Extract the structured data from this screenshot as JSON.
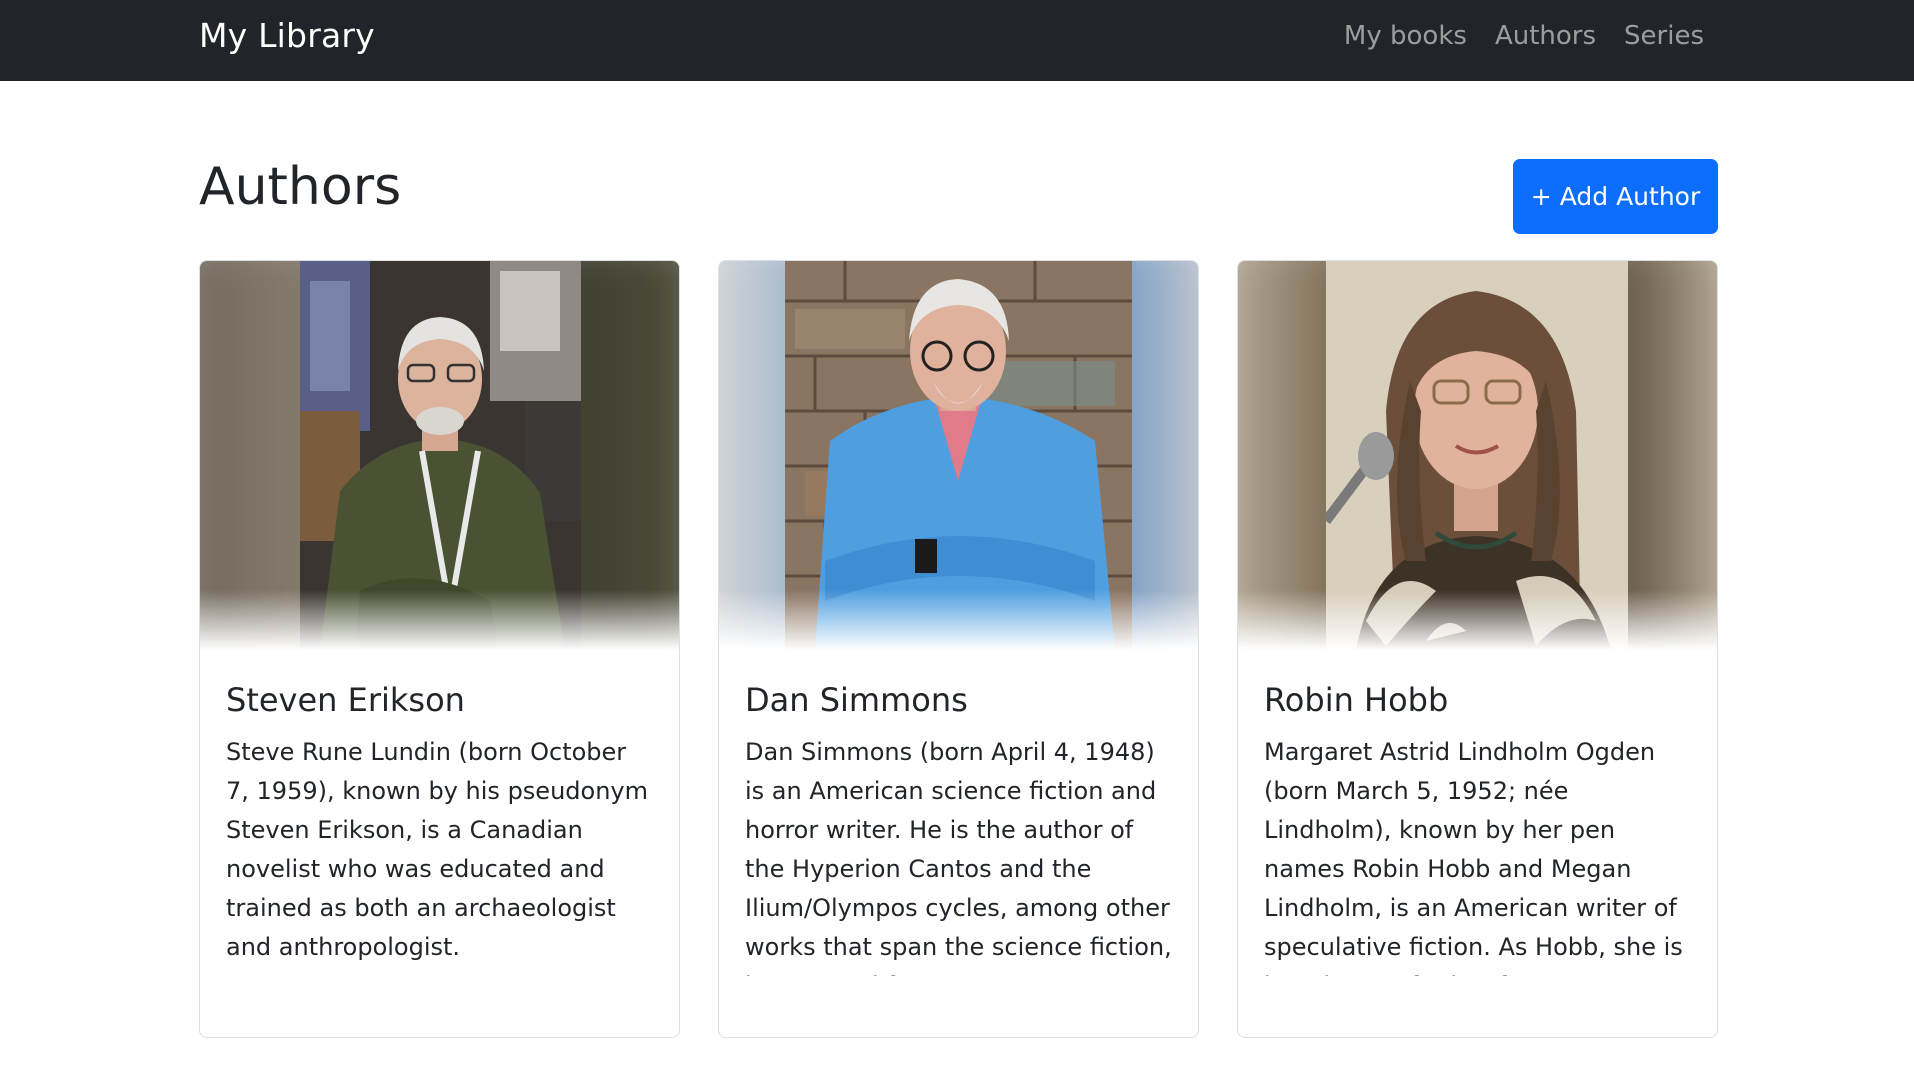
{
  "navbar": {
    "brand": "My Library",
    "links": [
      {
        "label": "My books"
      },
      {
        "label": "Authors"
      },
      {
        "label": "Series"
      }
    ]
  },
  "page": {
    "title": "Authors",
    "add_button_label": "Add Author",
    "add_button_icon": "+"
  },
  "authors": [
    {
      "name": "Steven Erikson",
      "bio": "Steve Rune Lundin (born October 7, 1959), known by his pseudonym Steven Erikson, is a Canadian novelist who was educated and trained as both an archaeologist and anthropologist."
    },
    {
      "name": "Dan Simmons",
      "bio": "Dan Simmons (born April 4, 1948) is an American science fiction and horror writer. He is the author of the Hyperion Cantos and the Ilium/Olympos cycles, among other works that span the science fiction, horror, and fantasy genres"
    },
    {
      "name": "Robin Hobb",
      "bio": "Margaret Astrid Lindholm Ogden (born March 5, 1952; née Lindholm), known by her pen names Robin Hobb and Megan Lindholm, is an American writer of speculative fiction. As Hobb, she is best known for her fantasy"
    }
  ],
  "colors": {
    "navbar_bg": "#212529",
    "primary": "#0d6efd"
  }
}
